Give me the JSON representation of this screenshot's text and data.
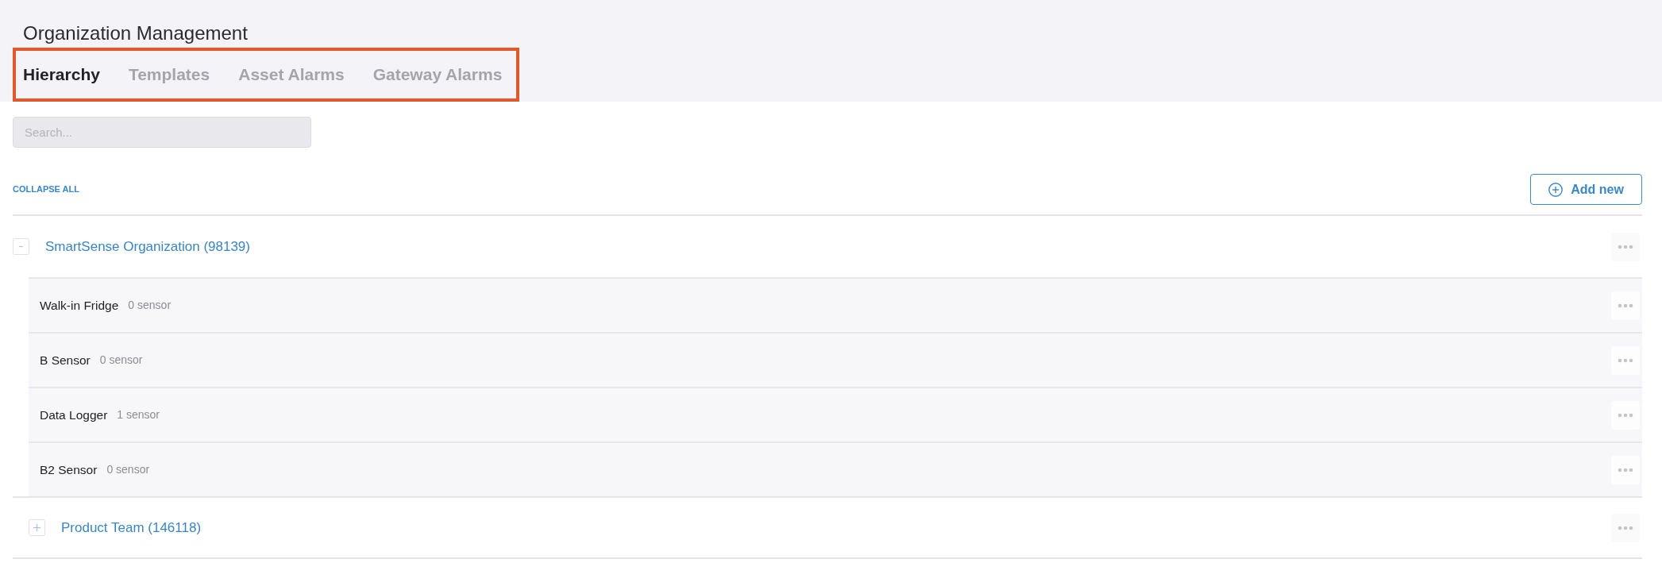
{
  "header": {
    "title": "Organization Management"
  },
  "tabs": [
    {
      "label": "Hierarchy",
      "selected": true
    },
    {
      "label": "Templates",
      "selected": false
    },
    {
      "label": "Asset Alarms",
      "selected": false
    },
    {
      "label": "Gateway Alarms",
      "selected": false
    }
  ],
  "search": {
    "placeholder": "Search..."
  },
  "toolbar": {
    "collapse_all": "COLLAPSE ALL",
    "add_button": "Add new"
  },
  "tree": [
    {
      "kind": "organization",
      "name": "SmartSense Organization (98139)",
      "expanded": true,
      "children": [
        {
          "kind": "asset",
          "name": "Walk-in Fridge",
          "sensor_count": "0 sensor"
        },
        {
          "kind": "asset",
          "name": "B Sensor",
          "sensor_count": "0 sensor"
        },
        {
          "kind": "asset",
          "name": "Data Logger",
          "sensor_count": "1 sensor"
        },
        {
          "kind": "asset",
          "name": "B2 Sensor",
          "sensor_count": "0 sensor"
        },
        {
          "kind": "organization",
          "name": "Product Team (146118)",
          "expanded": false
        }
      ]
    }
  ]
}
